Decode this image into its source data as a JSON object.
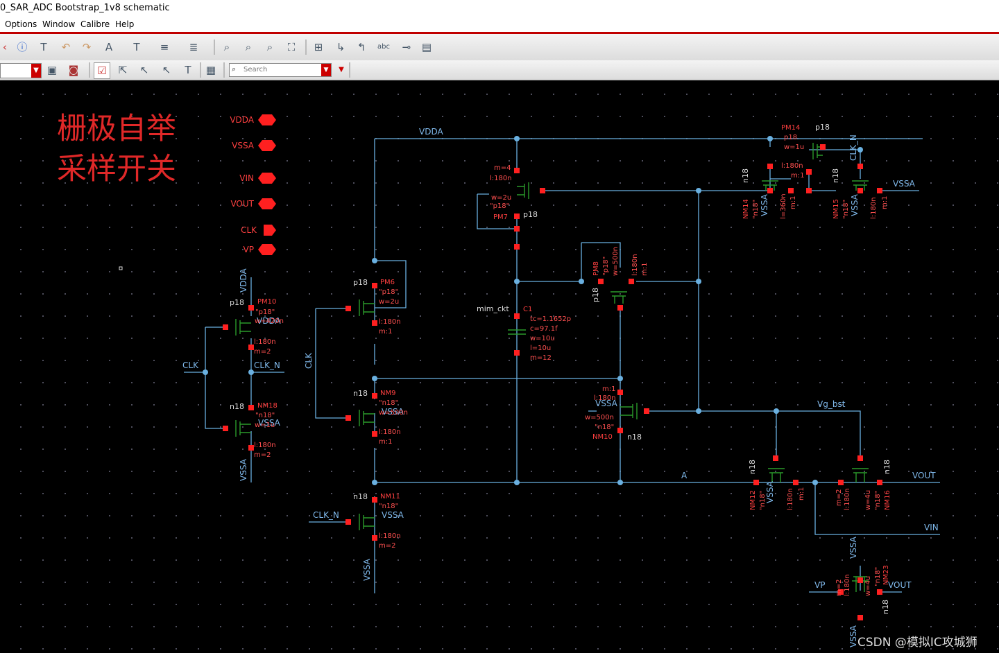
{
  "window": {
    "title": "0_SAR_ADC Bootstrap_1v8 schematic"
  },
  "menu": [
    "Options",
    "Window",
    "Calibre",
    "Help"
  ],
  "toolbar": {
    "search_placeholder": "Search"
  },
  "schematic": {
    "annotation_line1": "栅极自举",
    "annotation_line2": "采样开关",
    "pins": [
      "VDDA",
      "VSSA",
      "VIN",
      "VOUT",
      "CLK",
      "VP"
    ],
    "nets": {
      "vdda": "VDDA",
      "vssa": "VSSA",
      "vin": "VIN",
      "vout": "VOUT",
      "clk": "CLK",
      "clk_n": "CLK_N",
      "vp": "VP",
      "vg_bst": "Vg_bst",
      "a": "A"
    },
    "devices": {
      "PM14": {
        "name": "PM14",
        "model": "p18",
        "w": "w=1u",
        "l": "l:180n",
        "m": "m:1"
      },
      "NM14": {
        "name": "NM14",
        "model": "\"n18\"",
        "l": "l=360n",
        "m": "m:1"
      },
      "NM15": {
        "name": "NM15",
        "model": "\"n18\"",
        "l": "l:180n",
        "m": "m:1"
      },
      "PM7": {
        "name": "PM7",
        "model": "p18",
        "m": "m=4",
        "l": "l:180n",
        "w": "w=2u",
        "q": "\"p18\""
      },
      "PM8": {
        "name": "PM8",
        "model": "p18",
        "q": "\"p18\"",
        "w": "w=500n",
        "l": "l:180n",
        "m": "m:1"
      },
      "C1": {
        "name": "C1",
        "model": "mim_ckt",
        "tc": "tc=1.1652p",
        "c": "c=97.1f",
        "w": "w=10u",
        "l": "l=10u",
        "m": "m=12"
      },
      "PM6": {
        "name": "PM6",
        "model": "p18",
        "q": "\"p18\"",
        "w": "w=2u",
        "l": "l:180n",
        "m": "m:1"
      },
      "NM9": {
        "name": "NM9",
        "model": "n18",
        "q": "\"n18\"",
        "w": "w=500n",
        "l": "l:180n",
        "m": "m:1"
      },
      "NM11": {
        "name": "NM11",
        "model": "n18",
        "q": "\"n18\"",
        "l": "l:180n",
        "m": "m=2"
      },
      "PM10": {
        "name": "PM10",
        "model": "p18",
        "q": "\"p18\"",
        "w": "w=420n",
        "l": "l:180n",
        "m": "m=2"
      },
      "NM18": {
        "name": "NM18",
        "model": "n18",
        "q": "\"n18\"",
        "w": "w=1u",
        "l": "l:180n",
        "m": "m=2"
      },
      "NM10": {
        "name": "NM10",
        "model": "n18",
        "q": "\"n18\"",
        "w": "w=500n",
        "l": "l:180n",
        "m": "m:1"
      },
      "NM12": {
        "name": "NM12",
        "model": "n18",
        "q": "\"n18\"",
        "l": "l:180n",
        "m": "m:1"
      },
      "NM16": {
        "name": "NM16",
        "model": "n18",
        "q": "\"n18\"",
        "w": "w=4u",
        "l": "l:180n",
        "m": "m=2"
      },
      "NM23": {
        "name": "NM23",
        "model": "n18",
        "q": "\"n18\"",
        "w": "w=4u",
        "l": "l:180n",
        "m": "m=2"
      }
    }
  },
  "watermark": "CSDN @模拟IC攻城狮",
  "colors": {
    "wire": "#6ab0e0",
    "device": "#2a9a2a",
    "pin": "#ff2020",
    "label": "#ff4040",
    "annotation": "#e02828",
    "netlabel": "#7fb8ea"
  }
}
